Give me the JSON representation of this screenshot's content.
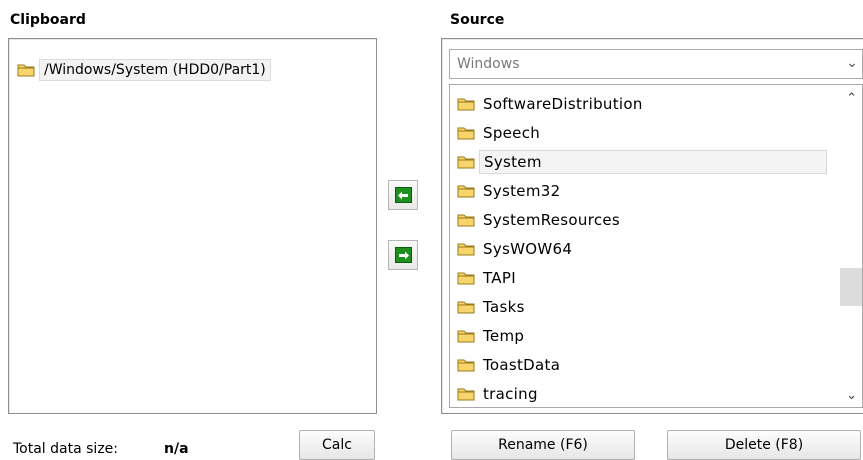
{
  "clipboard": {
    "header": "Clipboard",
    "items": [
      {
        "label": "/Windows/System (HDD0/Part1)",
        "selected": true
      }
    ],
    "total_label": "Total data size:",
    "total_value": "n/a",
    "calc_label": "Calc"
  },
  "source": {
    "header": "Source",
    "dropdown_value": "Windows",
    "folders": [
      {
        "label": "SoftwareDistribution"
      },
      {
        "label": "Speech"
      },
      {
        "label": "System",
        "selected": true
      },
      {
        "label": "System32"
      },
      {
        "label": "SystemResources"
      },
      {
        "label": "SysWOW64"
      },
      {
        "label": "TAPI"
      },
      {
        "label": "Tasks"
      },
      {
        "label": "Temp"
      },
      {
        "label": "ToastData"
      },
      {
        "label": "tracing"
      }
    ],
    "rename_label": "Rename (F6)",
    "delete_label": "Delete (F8)"
  },
  "colors": {
    "arrow_green": "#1f8f1f",
    "folder_yellow": "#f7d56a"
  },
  "icons": [
    "folder-icon",
    "arrow-left-icon",
    "arrow-right-icon",
    "chevron-down-icon",
    "scroll-up-icon",
    "scroll-down-icon"
  ]
}
